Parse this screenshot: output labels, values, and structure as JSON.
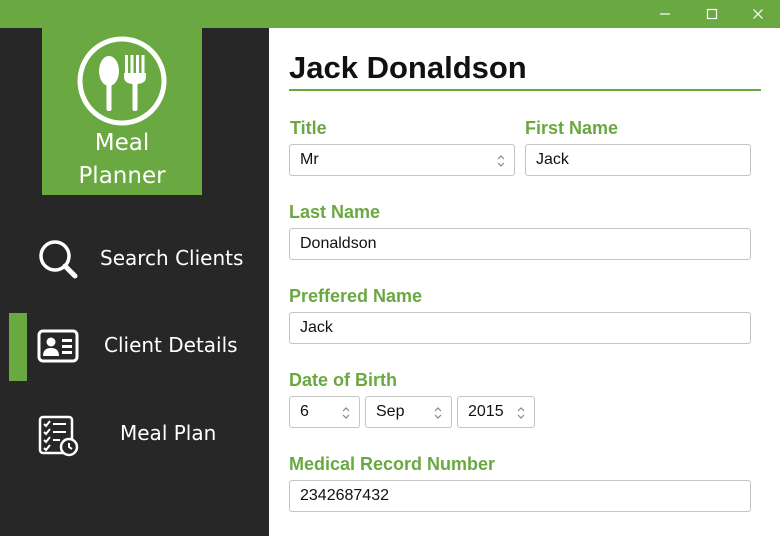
{
  "window": {
    "controls": {
      "minimize": "minimize-icon",
      "maximize": "maximize-icon",
      "close": "close-icon"
    }
  },
  "app": {
    "name_line1": "Meal",
    "name_line2": "Planner",
    "logo_icon": "spoon-fork-icon",
    "accent_color": "#6aa841",
    "sidebar_color": "#272727"
  },
  "nav": {
    "items": [
      {
        "label": "Search Clients",
        "icon": "search-icon",
        "active": false
      },
      {
        "label": "Client Details",
        "icon": "id-card-icon",
        "active": true
      },
      {
        "label": "Meal Plan",
        "icon": "checklist-clock-icon",
        "active": false
      }
    ]
  },
  "client": {
    "full_name": "Jack Donaldson",
    "title_label": "Title",
    "title_value": "Mr",
    "first_name_label": "First Name",
    "first_name_value": "Jack",
    "last_name_label": "Last Name",
    "last_name_value": "Donaldson",
    "preferred_name_label": "Preffered Name",
    "preferred_name_value": "Jack",
    "dob_label": "Date of Birth",
    "dob_day": "6",
    "dob_month": "Sep",
    "dob_year": "2015",
    "mrn_label": "Medical Record Number",
    "mrn_value": "2342687432"
  }
}
